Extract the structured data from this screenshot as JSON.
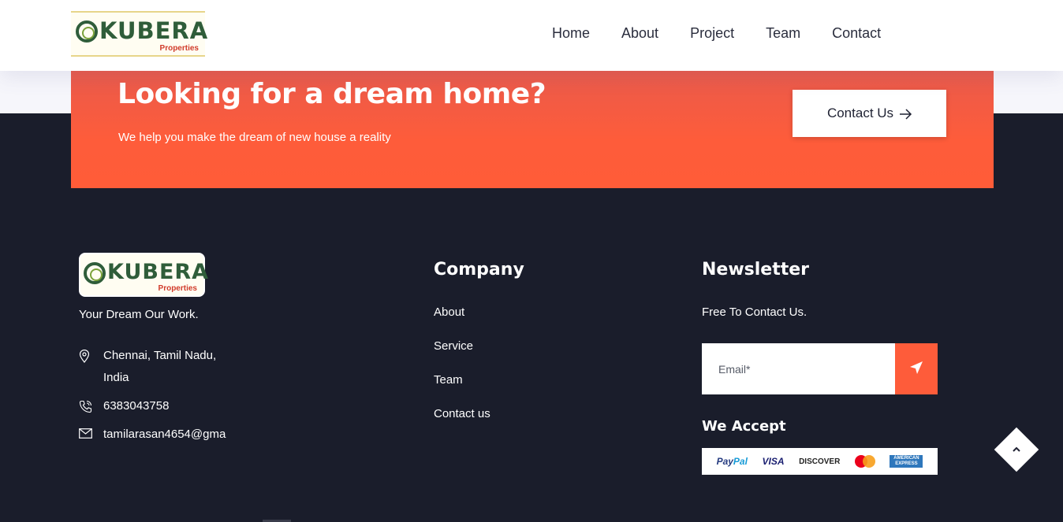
{
  "header": {
    "logo": {
      "text": "KUBERA",
      "sub": "Properties"
    },
    "nav": [
      "Home",
      "About",
      "Project",
      "Team",
      "Contact"
    ]
  },
  "cta": {
    "title": "Looking for a dream home?",
    "subtitle": "We help you make the dream of new house a reality",
    "button_label": "Contact Us"
  },
  "footer": {
    "logo": {
      "text": "KUBERA",
      "sub": "Properties"
    },
    "tagline": "Your Dream Our Work.",
    "address": "Chennai, Tamil Nadu, India",
    "phone": "6383043758",
    "email": "tamilarasan4654@gma",
    "company": {
      "title": "Company",
      "links": [
        "About",
        "Service",
        "Team",
        "Contact us"
      ]
    },
    "newsletter": {
      "title": "Newsletter",
      "text": "Free To Contact Us.",
      "email_placeholder": "Email*"
    },
    "we_accept": {
      "title": "We Accept",
      "cards": [
        "PayPal",
        "VISA",
        "DISCOVER",
        "mastercard",
        "AMERICAN EXPRESS"
      ]
    }
  },
  "colors": {
    "accent": "#fe5c3a",
    "footer_bg": "#1a1d2b",
    "header_bg": "#ffffff"
  },
  "icons": [
    "location-pin-icon",
    "phone-icon",
    "mail-icon",
    "send-icon",
    "arrow-right-icon",
    "chevron-up-icon"
  ]
}
